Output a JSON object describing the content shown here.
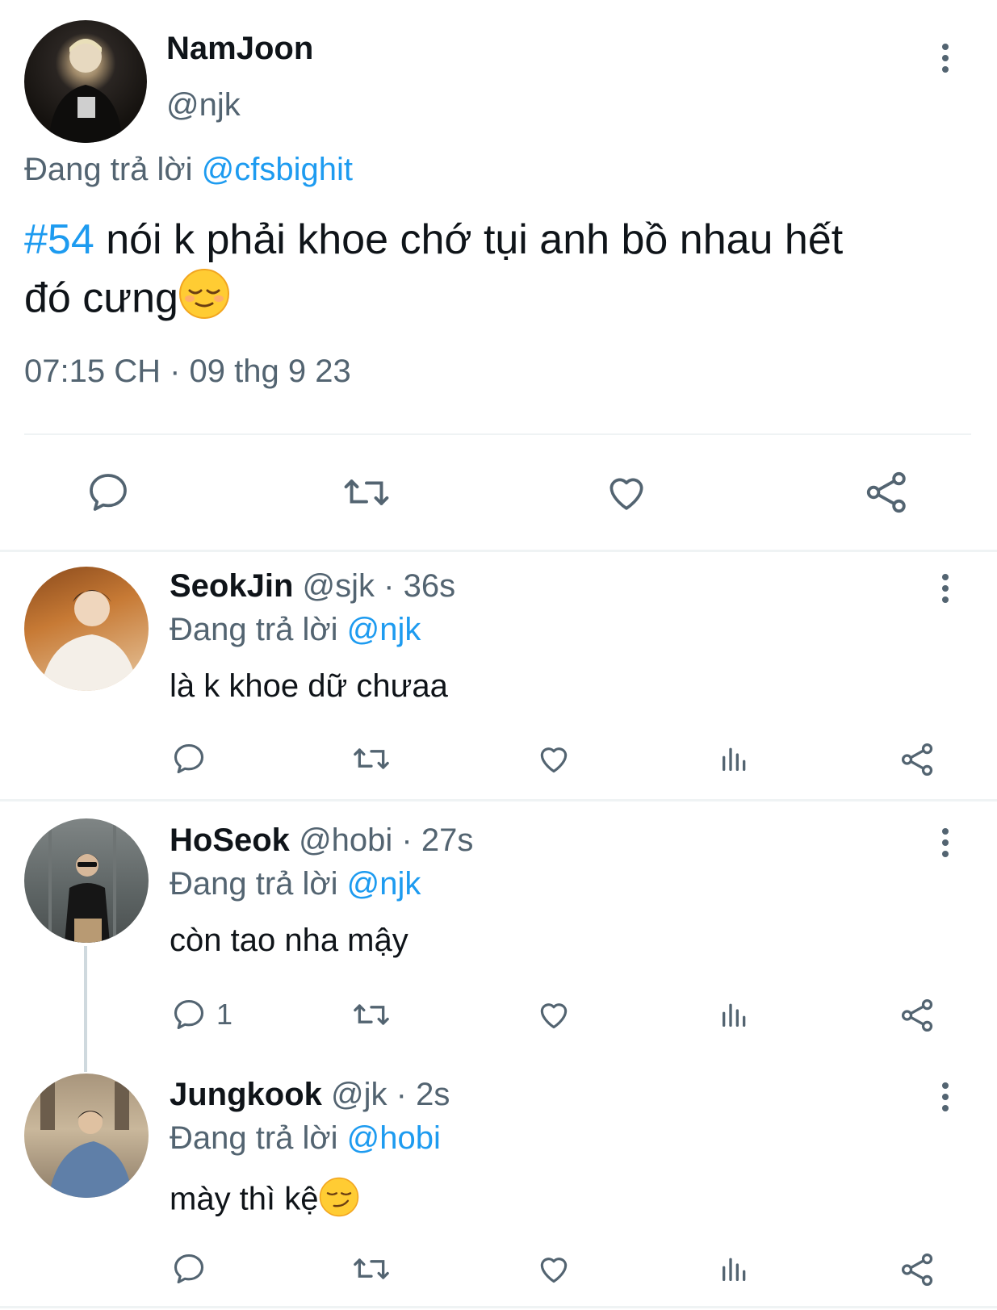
{
  "main_tweet": {
    "display_name": "NamJoon",
    "handle": "@njk",
    "replying_prefix": "Đang trả lời",
    "replying_to": "@cfsbighit",
    "hashtag": "#54",
    "text_line1": "nói k phải khoe chớ tụi anh bồ nhau hết",
    "text_line2": "đó cưng",
    "emoji": "relieved-face-emoji",
    "timestamp": "07:15 CH · 09 thg 9 23",
    "actions": [
      "reply-icon",
      "retweet-icon",
      "like-icon",
      "share-icon"
    ]
  },
  "replies": [
    {
      "display_name": "SeokJin",
      "handle": "@sjk",
      "time": "· 36s",
      "replying_prefix": "Đang trả lời",
      "replying_to": "@njk",
      "text": "là k khoe dữ chưaa",
      "reply_count": ""
    },
    {
      "display_name": "HoSeok",
      "handle": "@hobi",
      "time": "· 27s",
      "replying_prefix": "Đang trả lời",
      "replying_to": "@njk",
      "text": "còn tao nha mậy",
      "reply_count": "1"
    },
    {
      "display_name": "Jungkook",
      "handle": "@jk",
      "time": "· 2s",
      "replying_prefix": "Đang trả lời",
      "replying_to": "@hobi",
      "text": "mày thì kệ",
      "emoji": "smirking-face-emoji",
      "reply_count": ""
    }
  ],
  "colors": {
    "accent": "#1d9bf0",
    "secondary_text": "#536471",
    "icon": "#536471",
    "divider": "#eff3f4"
  }
}
